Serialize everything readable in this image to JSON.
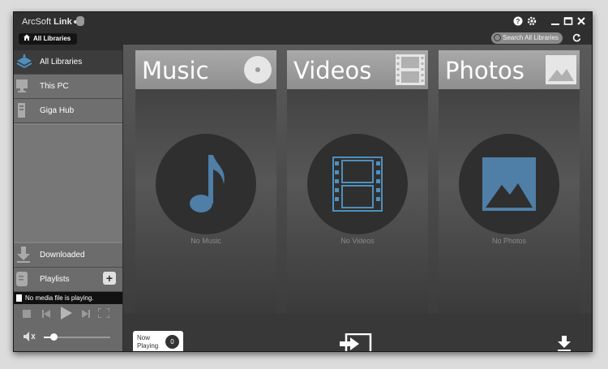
{
  "app": {
    "name_prefix": "ArcSoft ",
    "name_brand": "Link"
  },
  "breadcrumb": {
    "label": "All Libraries"
  },
  "search": {
    "placeholder": "Search All Libraries"
  },
  "sidebar": {
    "items": [
      {
        "label": "All Libraries",
        "icon": "all-libraries-icon",
        "active": true
      },
      {
        "label": "This PC",
        "icon": "pc-icon",
        "active": false
      },
      {
        "label": "Giga Hub",
        "icon": "hub-icon",
        "active": false
      }
    ],
    "downloaded_label": "Downloaded",
    "playlists_label": "Playlists"
  },
  "player": {
    "status": "No media file is playing.",
    "volume": 0.15
  },
  "panels": [
    {
      "title": "Music",
      "empty_text": "No Music",
      "icon": "music-note-icon"
    },
    {
      "title": "Videos",
      "empty_text": "No Videos",
      "icon": "film-icon"
    },
    {
      "title": "Photos",
      "empty_text": "No Photos",
      "icon": "photo-icon"
    }
  ],
  "now_playing": {
    "line1": "Now",
    "line2": "Playing",
    "count": "0"
  },
  "colors": {
    "accent_blue": "#4f8fbd",
    "window_bg": "#2f2f2f",
    "panel_header": "#9c9c9c"
  }
}
